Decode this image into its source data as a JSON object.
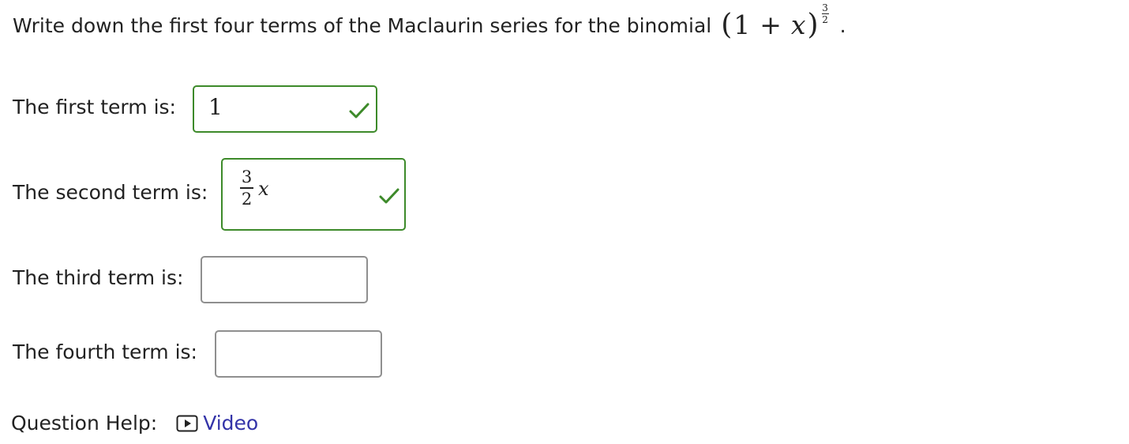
{
  "question": {
    "text": "Write down the first four terms of the Maclaurin series for the binomial",
    "expression": {
      "open_paren": "(",
      "one": "1",
      "plus": "+",
      "variable": "x",
      "close_paren": ")",
      "exponent_numerator": "3",
      "exponent_denominator": "2"
    },
    "end_punct": "."
  },
  "terms": [
    {
      "label": "The first term is:",
      "value": "1",
      "status": "correct"
    },
    {
      "label": "The second term is:",
      "value_numerator": "3",
      "value_denominator": "2",
      "value_variable": "x",
      "status": "correct"
    },
    {
      "label": "The third term is:",
      "value": "",
      "status": "empty"
    },
    {
      "label": "The fourth term is:",
      "value": "",
      "status": "empty"
    }
  ],
  "help": {
    "label": "Question Help:",
    "video_label": "Video",
    "video_icon": "play-video-icon"
  },
  "colors": {
    "correct_border": "#3d8a2a",
    "empty_border": "#8f8f8f",
    "link": "#3333a8"
  }
}
